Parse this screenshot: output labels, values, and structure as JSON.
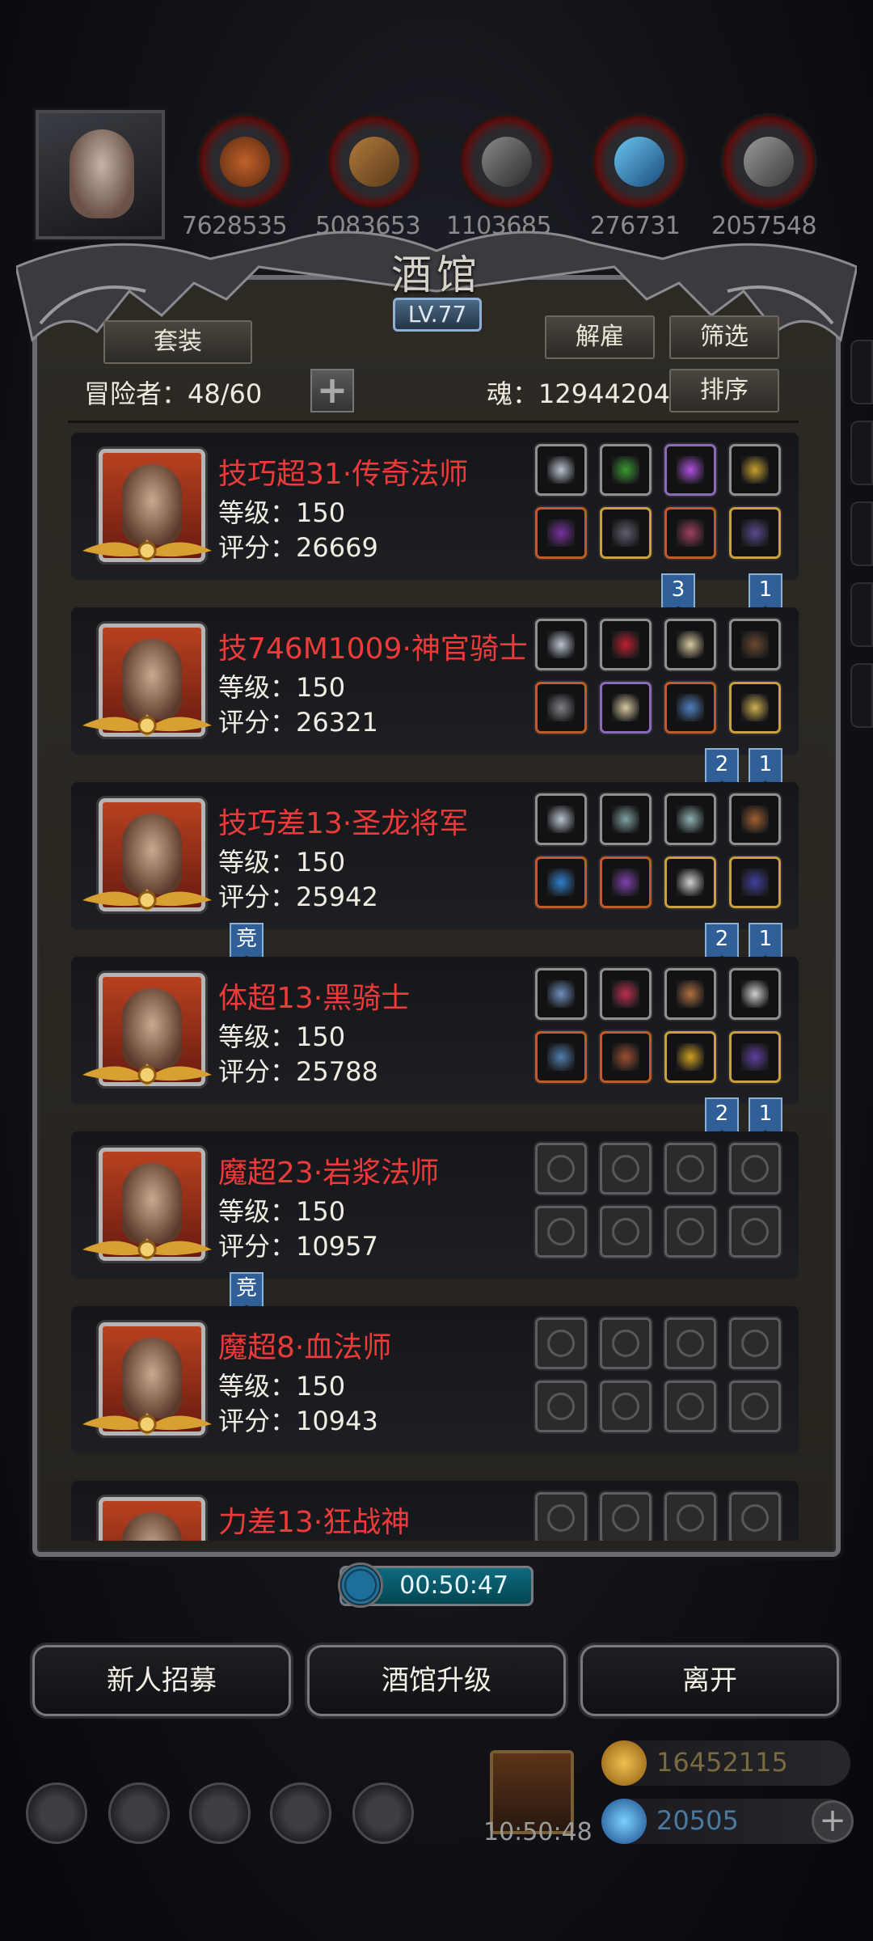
{
  "resources": [
    "7628535",
    "5083653",
    "1103685",
    "276731",
    "2057548"
  ],
  "tavern": {
    "title": "酒馆",
    "level": "LV.77",
    "set_button": "套装",
    "dismiss_button": "解雇",
    "filter_button": "筛选",
    "sort_button": "排序",
    "adventurers": "冒险者：48/60",
    "soul": "魂：12944204"
  },
  "heroes": [
    {
      "name": "技巧超31·传奇法师",
      "level": "等级：150",
      "score": "评分：26669",
      "flags": [
        "3",
        "1"
      ],
      "badge": ""
    },
    {
      "name": "技746M1009·神官骑士",
      "level": "等级：150",
      "score": "评分：26321",
      "flags": [
        "2",
        "1"
      ],
      "badge": ""
    },
    {
      "name": "技巧差13·圣龙将军",
      "level": "等级：150",
      "score": "评分：25942",
      "flags": [
        "2",
        "1"
      ],
      "badge": "竞"
    },
    {
      "name": "体超13·黑骑士",
      "level": "等级：150",
      "score": "评分：25788",
      "flags": [
        "2",
        "1"
      ],
      "badge": ""
    },
    {
      "name": "魔超23·岩浆法师",
      "level": "等级：150",
      "score": "评分：10957",
      "flags": [],
      "badge": "竞"
    },
    {
      "name": "魔超8·血法师",
      "level": "等级：150",
      "score": "评分：10943",
      "flags": [],
      "badge": ""
    },
    {
      "name": "力差13·狂战神",
      "level": "",
      "score": "",
      "flags": [],
      "badge": ""
    }
  ],
  "timer": "00:50:47",
  "buttons": {
    "recruit": "新人招募",
    "upgrade": "酒馆升级",
    "leave": "离开"
  },
  "gift_timer": "10:50:48",
  "currency": {
    "gold": "16452115",
    "gems": "20505"
  },
  "colors": {
    "hero_name": "#ef3a3a",
    "gold": "#c9a23a",
    "accent_blue": "#2f5f96"
  }
}
